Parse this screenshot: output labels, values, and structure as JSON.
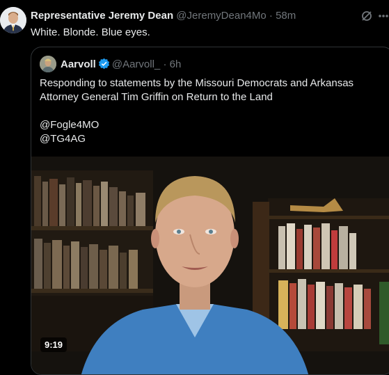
{
  "tweet": {
    "author_name": "Representative Jeremy Dean",
    "author_handle": "@JeremyDean4Mo",
    "separator": "·",
    "time": "58m",
    "text": "White. Blonde. Blue eyes."
  },
  "quote": {
    "author_name": "Aarvoll",
    "author_handle": "@Aarvoll_",
    "separator": "·",
    "time": "6h",
    "line1": "Responding to statements by the Missouri Democrats and Arkansas",
    "line2": "Attorney General Tim Griffin on Return to the Land",
    "mention1": "@Fogle4MO",
    "mention2": "@TG4AG"
  },
  "video": {
    "duration": "9:19",
    "verified_color": "#1d9bf0",
    "shirt_color": "#3f7fc0"
  }
}
